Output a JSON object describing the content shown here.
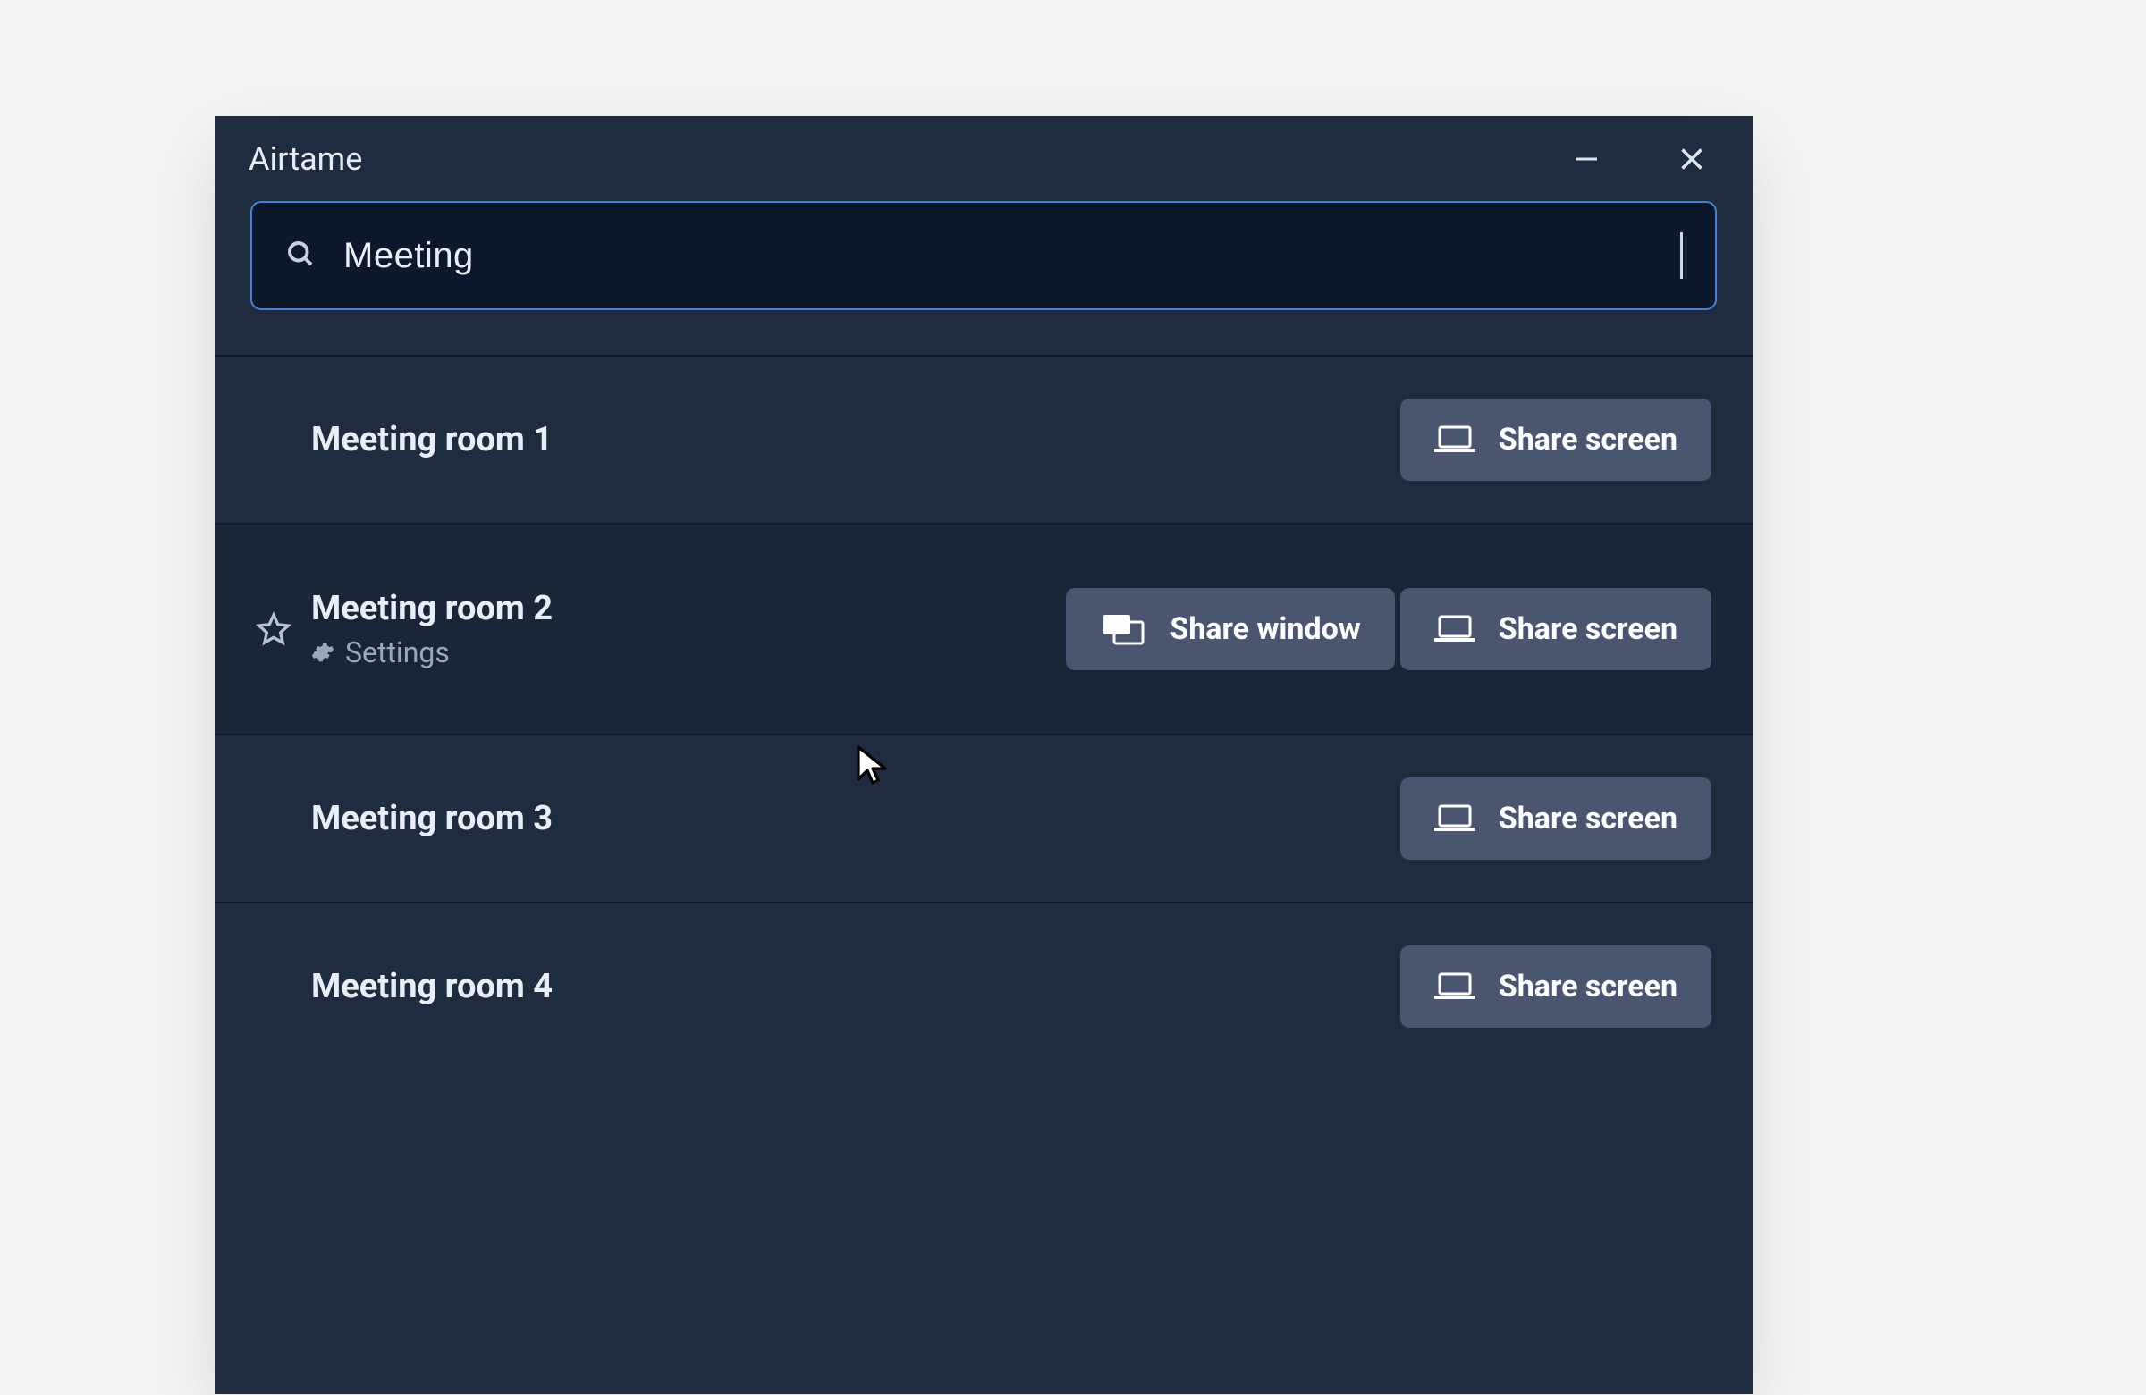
{
  "app": {
    "title": "Airtame"
  },
  "search": {
    "value": "Meeting"
  },
  "buttons": {
    "share_screen": "Share screen",
    "share_window": "Share window"
  },
  "rooms": [
    {
      "name": "Meeting room 1",
      "hovered": false,
      "show_star": false,
      "settings_label": null
    },
    {
      "name": "Meeting room 2",
      "hovered": true,
      "show_star": true,
      "settings_label": "Settings"
    },
    {
      "name": "Meeting room 3",
      "hovered": false,
      "show_star": false,
      "settings_label": null
    },
    {
      "name": "Meeting room 4",
      "hovered": false,
      "show_star": false,
      "settings_label": null
    }
  ]
}
